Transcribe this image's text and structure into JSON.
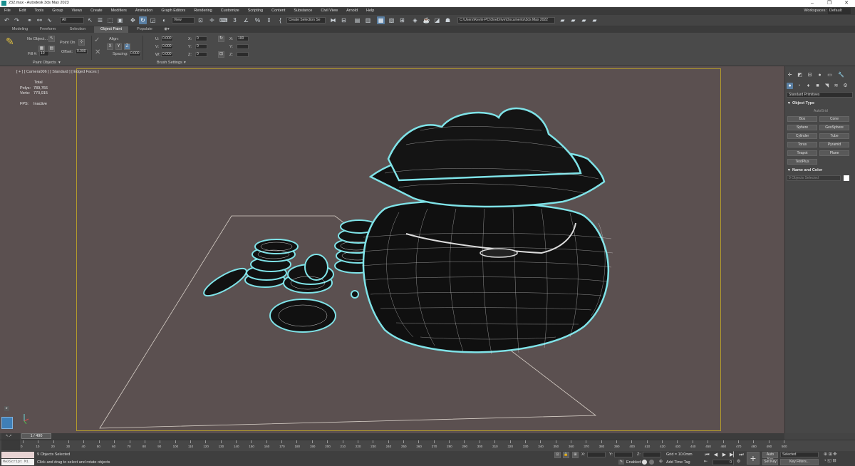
{
  "titlebar": {
    "title": "232.max - Autodesk 3ds Max 2023"
  },
  "menu": [
    "File",
    "Edit",
    "Tools",
    "Group",
    "Views",
    "Create",
    "Modifiers",
    "Animation",
    "Graph Editors",
    "Rendering",
    "Customize",
    "Scripting",
    "Content",
    "Substance",
    "Civil View",
    "Arnold",
    "Help"
  ],
  "workspaces": {
    "label": "Workspaces:",
    "value": "Default"
  },
  "toolbar": {
    "filter_value": "All",
    "ref_coord": "View",
    "selection_set": "Create Selection Se",
    "project_path": "C:\\Users\\Kevin-PC\\OneDrive\\Documents\\3ds Max 2022"
  },
  "ribbon_tabs": [
    "Modeling",
    "Freeform",
    "Selection",
    "Object Paint",
    "Populate"
  ],
  "ribbon": {
    "paint_on_label": "No Object...",
    "paint_on": "Point On",
    "fill_label": "Fill #:",
    "fill_value": "10",
    "offset_label": "Offset:",
    "offset_value": "0.000",
    "align_label": "Align:",
    "axis_x": "X",
    "axis_y": "Y",
    "axis_z": "Z",
    "spacing_label": "Spacing:",
    "spacing_value": "0.000",
    "u_label": "U:",
    "u_value": "0.000",
    "v_label": "V:",
    "v_value": "0.000",
    "w_label": "W:",
    "w_value": "0.000",
    "x_label": "X:",
    "x_value": "0",
    "y_label": "Y:",
    "y_value": "0",
    "z_label": "Z:",
    "z_value": "0",
    "sx_label": "X:",
    "sx_value": "100",
    "sy_label": "Y:",
    "sz_label": "Z:",
    "paint_objects_footer": "Paint Objects",
    "brush_settings_footer": "Brush Settings"
  },
  "viewport": {
    "label": "[ + ] [ Camera006 ] [ Standard ] [ Edged Faces ]",
    "total_label": "Total",
    "polys_label": "Polys:",
    "polys_value": "789,766",
    "verts_label": "Verts:",
    "verts_value": "770,915",
    "fps_label": "FPS:",
    "fps_value": "Inactive"
  },
  "command_panel": {
    "category": "Standard Primitives",
    "object_type_header": "Object Type",
    "autogrid": "AutoGrid",
    "buttons": [
      "Box",
      "Cone",
      "Sphere",
      "GeoSphere",
      "Cylinder",
      "Tube",
      "Torus",
      "Pyramid",
      "Teapot",
      "Plane",
      "TextPlus"
    ],
    "name_color_header": "Name and Color",
    "name_placeholder": "9 Objects Selected"
  },
  "timeline": {
    "frame_indicator": "1 / 490",
    "ticks": [
      "0",
      "10",
      "20",
      "30",
      "40",
      "50",
      "60",
      "70",
      "80",
      "90",
      "100",
      "110",
      "120",
      "130",
      "140",
      "150",
      "160",
      "170",
      "180",
      "190",
      "200",
      "210",
      "220",
      "230",
      "240",
      "250",
      "260",
      "270",
      "280",
      "290",
      "300",
      "310",
      "320",
      "330",
      "340",
      "350",
      "360",
      "370",
      "380",
      "390",
      "400",
      "410",
      "420",
      "430",
      "440",
      "450",
      "460",
      "470",
      "480",
      "490",
      "500"
    ]
  },
  "status": {
    "maxscript_label": "MAXScript Mi",
    "objects_selected": "9 Objects Selected",
    "prompt": "Click and drag to select and rotate objects",
    "x_label": "X:",
    "y_label": "Y:",
    "z_label": "Z:",
    "grid": "Grid = 10.0mm",
    "enabled": "Enabled:",
    "add_time_tag": "Add Time Tag",
    "auto_key": "Auto Key",
    "set_key": "Set Key",
    "selected": "Selected",
    "key_filters": "Key Filters...",
    "frame_value": "0"
  },
  "colors": {
    "viewport_bg": "#5b5050",
    "active_border": "#b29a2c",
    "selection_highlight": "#7fe3e8",
    "ui_accent": "#5a7fa3"
  }
}
